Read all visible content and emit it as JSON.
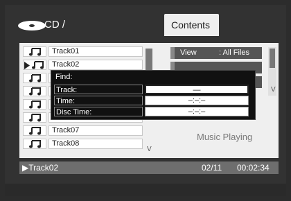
{
  "header": {
    "path": "CD /",
    "tab_label": "Contents"
  },
  "track_list": [
    {
      "name": "Track01",
      "playing": false
    },
    {
      "name": "Track02",
      "playing": true
    },
    {
      "name": "",
      "playing": false
    },
    {
      "name": "",
      "playing": false
    },
    {
      "name": "",
      "playing": false
    },
    {
      "name": "",
      "playing": false
    },
    {
      "name": "Track07",
      "playing": false
    },
    {
      "name": "Track08",
      "playing": false
    }
  ],
  "list_scroll_marker": "V",
  "right_pane": {
    "view_label": "View",
    "view_value": ": All Files",
    "scroll_marker": "V",
    "status_text": "Music Playing"
  },
  "find_dialog": {
    "title": "Find:",
    "fields": [
      {
        "label": "Track:",
        "value": "—",
        "active": true
      },
      {
        "label": "Time:",
        "value": "–:–:–",
        "active": false
      },
      {
        "label": "Disc Time:",
        "value": "–:–:–",
        "active": false
      }
    ]
  },
  "status_bar": {
    "current_track": "▶Track02",
    "track_count": "02/11",
    "elapsed_time": "00:02:34"
  }
}
